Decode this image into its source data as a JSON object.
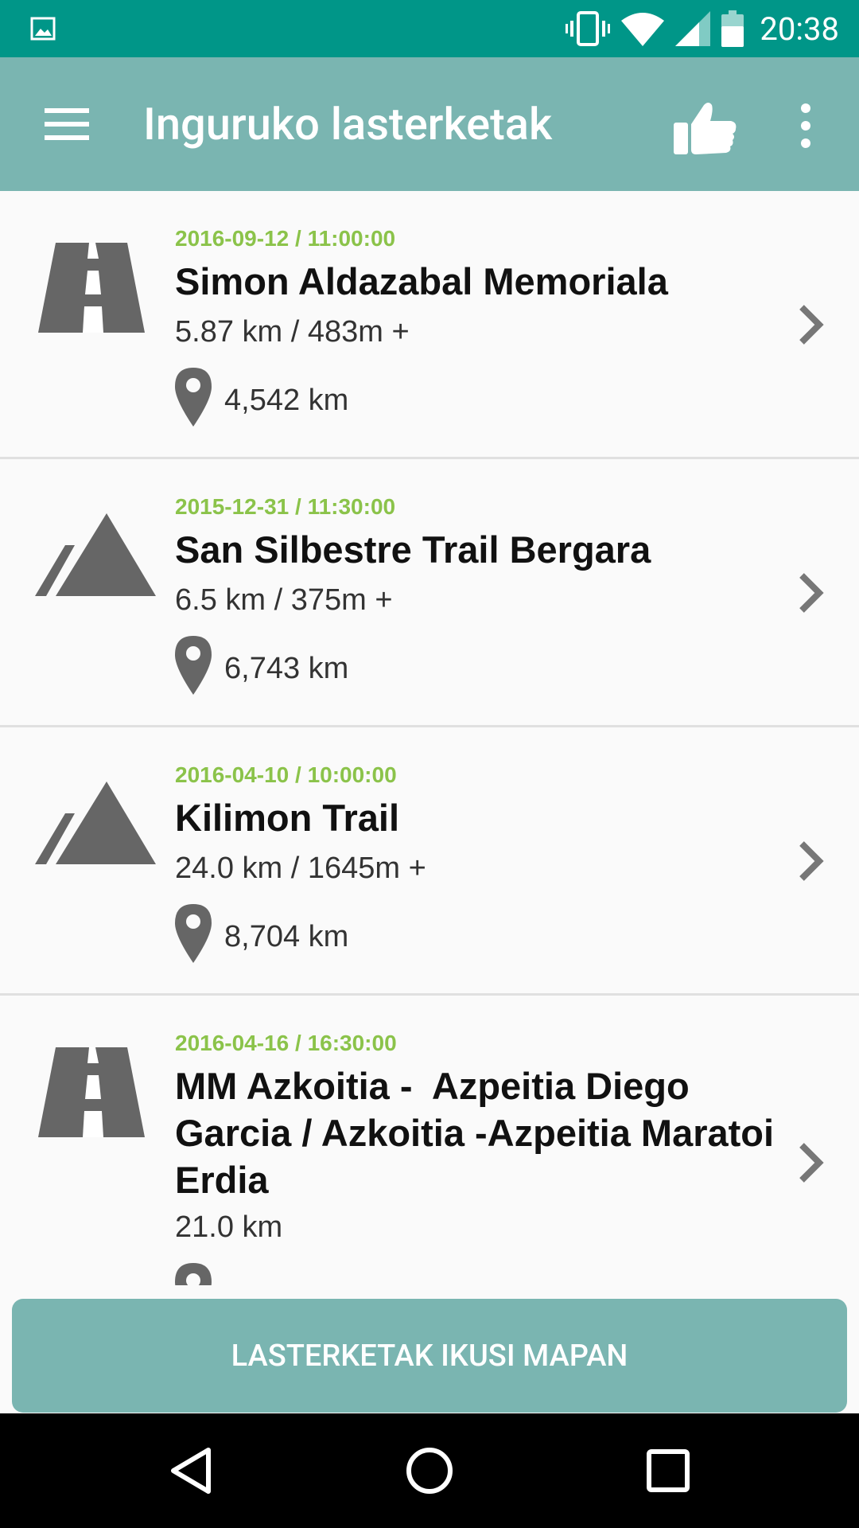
{
  "status_bar": {
    "time": "20:38",
    "icons": [
      "gallery-notification-icon",
      "vibrate-icon",
      "wifi-icon",
      "cell-signal-icon",
      "battery-icon"
    ]
  },
  "app_bar": {
    "title": "Inguruko lasterketak",
    "icons": [
      "menu-icon",
      "thumbs-up-icon",
      "more-vert-icon"
    ]
  },
  "races": [
    {
      "date": "2016-09-12 / 11:00:00",
      "name": "Simon Aldazabal Memoriala",
      "distance": "5.87 km / 483m +",
      "away": "4,542 km",
      "type_icon": "road-icon"
    },
    {
      "date": "2015-12-31 / 11:30:00",
      "name": "San Silbestre Trail Bergara",
      "distance": "6.5 km / 375m +",
      "away": "6,743 km",
      "type_icon": "mountain-icon"
    },
    {
      "date": "2016-04-10 / 10:00:00",
      "name": "Kilimon Trail",
      "distance": "24.0 km / 1645m +",
      "away": "8,704 km",
      "type_icon": "mountain-icon"
    },
    {
      "date": "2016-04-16 / 16:30:00",
      "name_lines": [
        "MM Azkoitia -  Azpeitia Diego",
        "Garcia / Azkoitia -Azpeitia Maratoi",
        "Erdia"
      ],
      "distance": "21.0 km",
      "type_icon": "road-icon"
    }
  ],
  "map_button": {
    "label": "LASTERKETAK IKUSI MAPAN"
  },
  "nav_bar": {
    "icons": [
      "back-icon",
      "home-icon",
      "recents-icon"
    ]
  },
  "colors": {
    "status_bar": "#009688",
    "app_bar": "#7ab5b1",
    "date_text": "#8bc34a",
    "icon_gray": "#666666"
  }
}
